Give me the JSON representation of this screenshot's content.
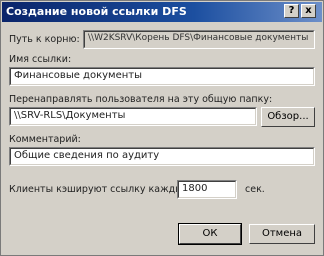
{
  "window": {
    "title": "Создание новой ссылки DFS",
    "help_glyph": "?",
    "close_glyph": "x"
  },
  "root": {
    "label": "Путь к корню:",
    "value": "\\\\W2KSRV\\Корень DFS\\Финансовые документы"
  },
  "link_name": {
    "label": "Имя ссылки:",
    "value": "Финансовые документы"
  },
  "redirect": {
    "label": "Перенаправлять пользователя на эту общую папку:",
    "value": "\\\\SRV-RLS\\Документы",
    "browse_label": "Обзор..."
  },
  "comment": {
    "label": "Комментарий:",
    "value": "Общие сведения по аудиту"
  },
  "cache": {
    "label": "Клиенты кэшируют ссылку каждые",
    "value": "1800",
    "unit": "сек."
  },
  "buttons": {
    "ok": "ОК",
    "cancel": "Отмена"
  }
}
